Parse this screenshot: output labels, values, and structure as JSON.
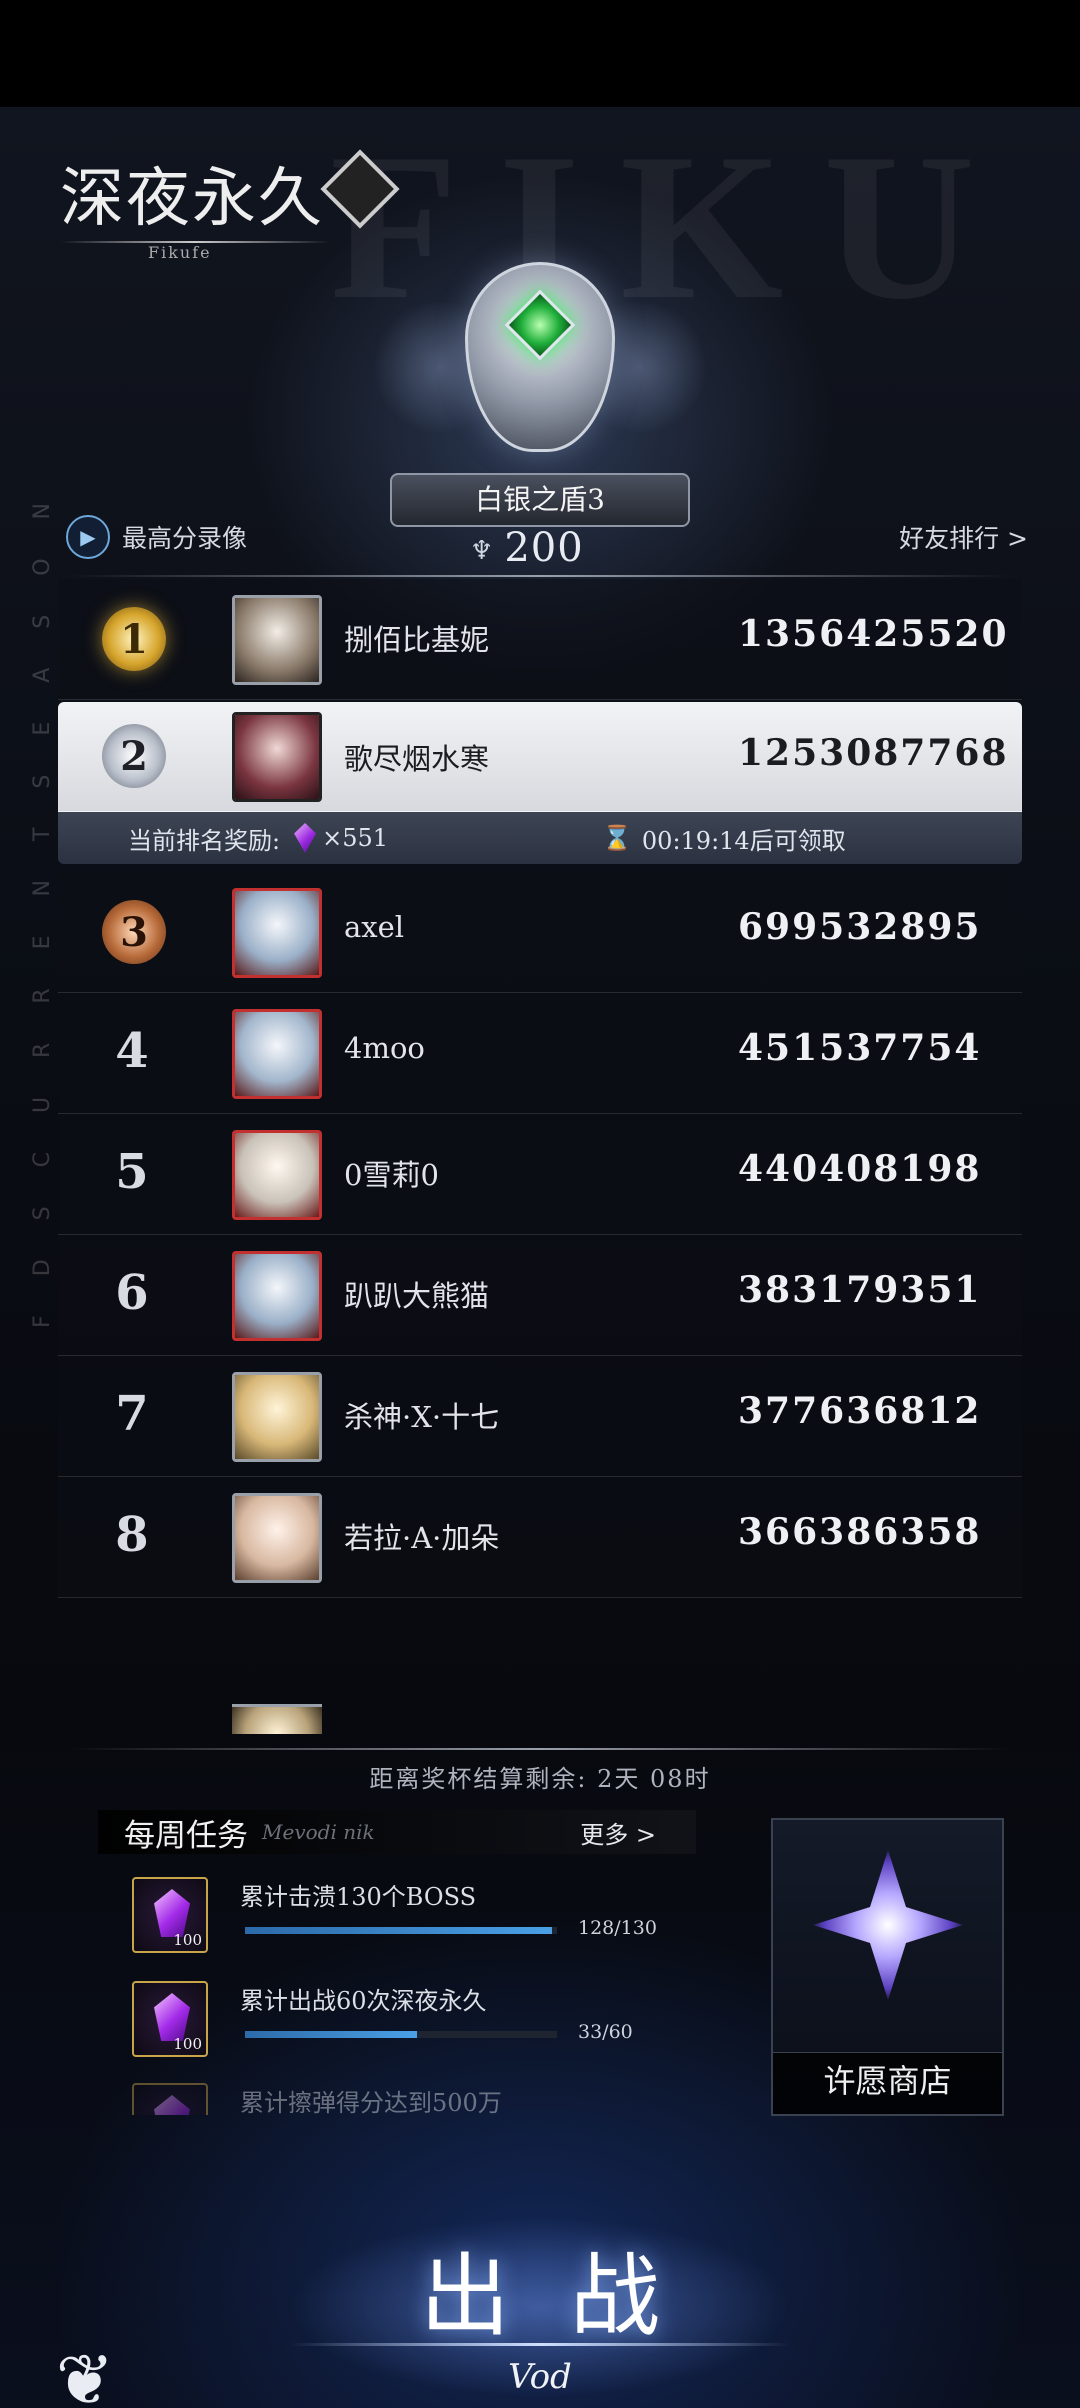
{
  "header": {
    "logo_title": "深夜永久",
    "logo_sub": "Fikufe",
    "bg_letters": "FIKU",
    "season_vertical": "F D S C U R R E N T   S E A S O N"
  },
  "rank": {
    "name": "白银之盾3",
    "trophies": "200"
  },
  "nav": {
    "high_score": "最高分录像",
    "friend_rank": "好友排行 >"
  },
  "leaderboard": [
    {
      "rank": "1",
      "name": "捌佰比基妮",
      "score": "1356425520"
    },
    {
      "rank": "2",
      "name": "歌尽烟水寒",
      "score": "1253087768"
    },
    {
      "rank": "3",
      "name": "axel",
      "score": "699532895"
    },
    {
      "rank": "4",
      "name": "4moo",
      "score": "451537754"
    },
    {
      "rank": "5",
      "name": "0雪莉0",
      "score": "440408198"
    },
    {
      "rank": "6",
      "name": "趴趴大熊猫",
      "score": "383179351"
    },
    {
      "rank": "7",
      "name": "杀神·X·十七",
      "score": "377636812"
    },
    {
      "rank": "8",
      "name": "若拉·A·加朵",
      "score": "366386358"
    }
  ],
  "reward": {
    "label": "当前排名奖励:",
    "amount": "×551",
    "timer": "00:19:14后可领取"
  },
  "season_timer": "距离奖杯结算剩余:  2天 08时",
  "weekly_tasks": {
    "title": "每周任务",
    "subtitle": "Mevodi nik",
    "more": "更多 >",
    "items": [
      {
        "label": "累计击溃130个BOSS",
        "progress_text": "128/130",
        "progress": 0.985,
        "reward_count": "100"
      },
      {
        "label": "累计出战60次深夜永久",
        "progress_text": "33/60",
        "progress": 0.55,
        "reward_count": "100"
      },
      {
        "label": "累计擦弹得分达到500万",
        "progress_text": "",
        "progress": 0,
        "reward_count": ""
      }
    ]
  },
  "wish_shop": {
    "label": "许愿商店"
  },
  "battle": {
    "label": "出战",
    "sub": "Vod"
  },
  "colors": {
    "accent_blue": "#4aa0e6",
    "gem_purple": "#a22ae8",
    "gold": "#d6a52c"
  }
}
